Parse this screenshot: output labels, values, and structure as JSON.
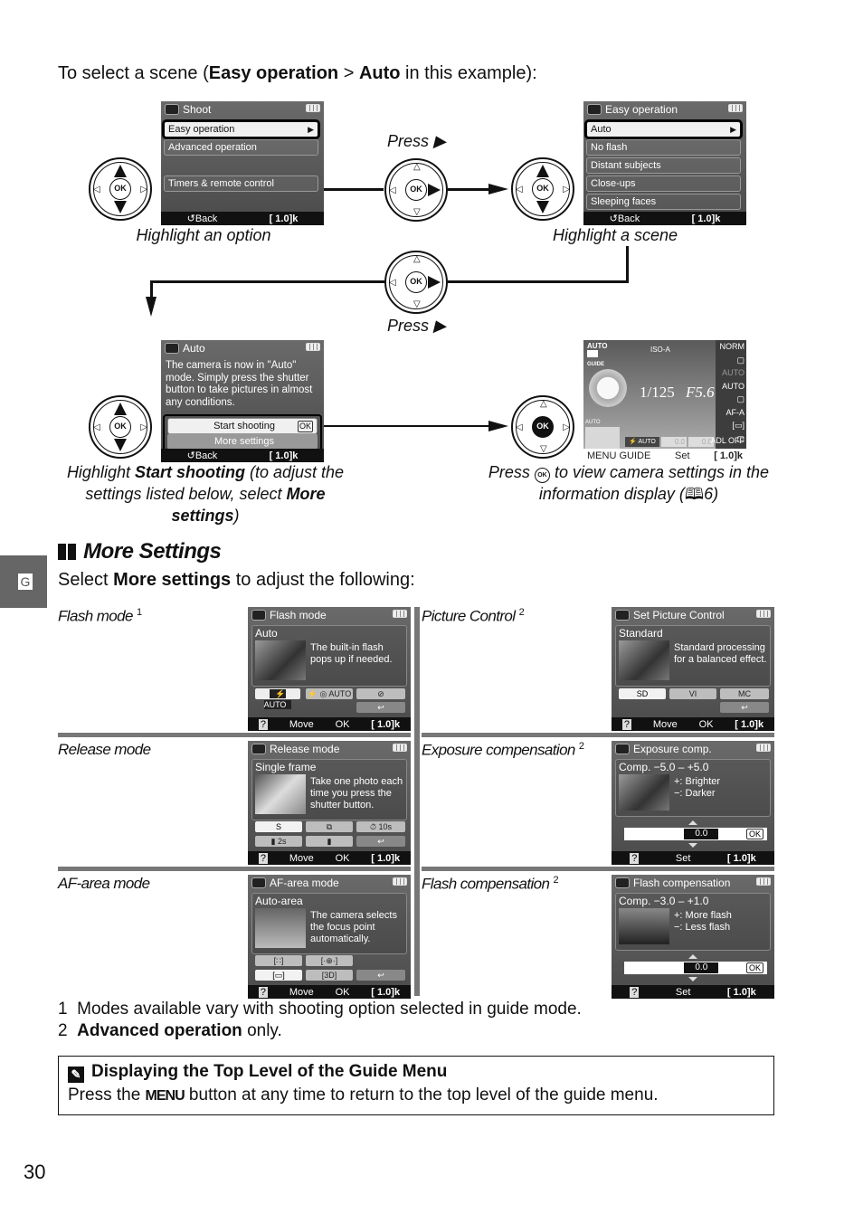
{
  "intro": {
    "prefix": "To select a scene (",
    "bold1": "Easy operation",
    "sep": " > ",
    "bold2": "Auto",
    "suffix": " in this example):"
  },
  "steps": {
    "press_label": "Press ▶",
    "caption1": "Highlight an option",
    "caption2": "Highlight a scene",
    "caption3": {
      "prefix": "Highlight ",
      "bold1": "Start shooting",
      "middle": " (to adjust the settings listed below, select ",
      "bold2": "More settings",
      "suffix": ")"
    },
    "caption4": {
      "prefix": "Press ",
      "ok_glyph": "OK",
      "middle": " to view camera settings in the information display (",
      "book_glyph": "ὖE",
      "page_ref": "6",
      "suffix": ")"
    }
  },
  "screens": {
    "shoot": {
      "title": "Shoot",
      "items": [
        "Easy operation",
        "Advanced operation",
        "",
        "Timers & remote control"
      ],
      "selected_index": 0,
      "bottom_back": "↺Back",
      "bottom_count": "[  1.0]k"
    },
    "easy": {
      "title": "Easy operation",
      "items": [
        "Auto",
        "No flash",
        "Distant subjects",
        "Close-ups",
        "Sleeping faces"
      ],
      "selected_index": 0,
      "bottom_back": "↺Back",
      "bottom_count": "[  1.0]k"
    },
    "auto": {
      "title": "Auto",
      "message": "The camera is now in \"Auto\" mode. Simply press the shutter button to take pictures in almost any conditions.",
      "buttons": [
        "Start shooting",
        "More settings"
      ],
      "ok_tag": "OK",
      "bottom_back": "↺Back",
      "bottom_count": "[  1.0]k"
    },
    "info": {
      "mode": "AUTO",
      "guide": "GUIDE",
      "iso": "ISO-A",
      "shutter": "1/125",
      "aperture": "F5.6",
      "qual": "NORM",
      "wb": "AUTO",
      "iso_val": "AUTO",
      "af": "AF-A",
      "adl": "OFF",
      "flash": "AUTO",
      "ev": "0.0",
      "fev": "0.0",
      "area": "AUTO",
      "bottom_menu": "MENU GUIDE",
      "bottom_set": "Set",
      "bottom_count": "[  1.0]k"
    }
  },
  "section": {
    "tab": "G",
    "title": "More Settings",
    "subtitle_prefix": "Select ",
    "subtitle_bold": "More settings",
    "subtitle_suffix": " to adjust the following:"
  },
  "settings": [
    {
      "label": "Flash mode",
      "note": "1",
      "screen": {
        "title": "Flash mode",
        "heading": "Auto",
        "desc": "The built-in flash pops up if needed.",
        "options": [
          "⚡ AUTO",
          "⚡ ◎ AUTO",
          "⊘",
          "↩"
        ],
        "selected_index": 0,
        "bottom": [
          "?",
          "Move",
          "OK",
          "[  1.0]k"
        ]
      }
    },
    {
      "label": "Picture Control",
      "note": "2",
      "screen": {
        "title": "Set Picture Control",
        "heading": "Standard",
        "desc": "Standard processing for a balanced effect.",
        "options": [
          "SD",
          "VI",
          "MC",
          "↩"
        ],
        "selected_index": 0,
        "bottom": [
          "?",
          "Move",
          "OK",
          "[  1.0]k"
        ]
      }
    },
    {
      "label": "Release mode",
      "note": "",
      "screen": {
        "title": "Release mode",
        "heading": "Single frame",
        "desc": "Take one photo each time you press the shutter button.",
        "options": [
          "S",
          "⧉",
          "⏱ 10s",
          "▮ 2s",
          "▮",
          "↩"
        ],
        "selected_index": 0,
        "bottom": [
          "?",
          "Move",
          "OK",
          "[  1.0]k"
        ]
      }
    },
    {
      "label": "Exposure compensation",
      "note": "2",
      "screen": {
        "title": "Exposure comp.",
        "heading": "Comp. −5.0 – +5.0",
        "desc": "+: Brighter\n−: Darker",
        "value": "0.0",
        "ok_tag": "OK",
        "bottom": [
          "?",
          "Set",
          "",
          "[  1.0]k"
        ]
      }
    },
    {
      "label": "AF-area mode",
      "note": "",
      "screen": {
        "title": "AF-area mode",
        "heading": "Auto-area",
        "desc": "The camera selects the focus point automatically.",
        "options": [
          "[∷]",
          "[·⊕·]",
          "[▭]",
          "[3D]",
          "↩"
        ],
        "selected_index": 2,
        "bottom": [
          "?",
          "Move",
          "OK",
          "[  1.0]k"
        ]
      }
    },
    {
      "label": "Flash compensation",
      "note": "2",
      "screen": {
        "title": "Flash compensation",
        "heading": "Comp. −3.0 – +1.0",
        "desc": "+: More flash\n−: Less flash",
        "value": "0.0",
        "ok_tag": "OK",
        "bottom": [
          "?",
          "Set",
          "",
          "[  1.0]k"
        ]
      }
    }
  ],
  "footnotes": [
    {
      "num": "1",
      "text": "Modes available vary with shooting option selected in guide mode.",
      "bold": ""
    },
    {
      "num": "2",
      "text": " only.",
      "bold": "Advanced operation"
    }
  ],
  "note": {
    "title": "Displaying the Top Level of the Guide Menu",
    "body_prefix": "Press the ",
    "menu_key": "MENU",
    "body_suffix": " button at any time to return to the top level of the guide menu."
  },
  "page_number": "30"
}
